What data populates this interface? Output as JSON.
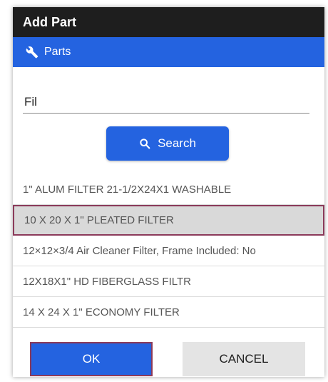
{
  "dialog": {
    "title": "Add Part"
  },
  "section": {
    "label": "Parts",
    "icon": "wrench-icon",
    "accent": "#2463e0"
  },
  "search": {
    "value": "Fil",
    "button_label": "Search",
    "button_icon": "search-icon"
  },
  "results": [
    {
      "label": "1\" ALUM FILTER 21-1/2X24X1 WASHABLE",
      "selected": false
    },
    {
      "label": "10 X 20 X 1\" PLEATED FILTER",
      "selected": true
    },
    {
      "label": "12×12×3/4 Air Cleaner Filter, Frame Included: No",
      "selected": false
    },
    {
      "label": "12X18X1\" HD FIBERGLASS FILTR",
      "selected": false
    },
    {
      "label": "14 X 24 X 1\" ECONOMY FILTER",
      "selected": false
    }
  ],
  "footer": {
    "ok_label": "OK",
    "cancel_label": "CANCEL"
  },
  "colors": {
    "titlebar": "#1e1e1e",
    "highlight_border": "#8b3a5a",
    "selected_bg": "#d9d9d9"
  }
}
